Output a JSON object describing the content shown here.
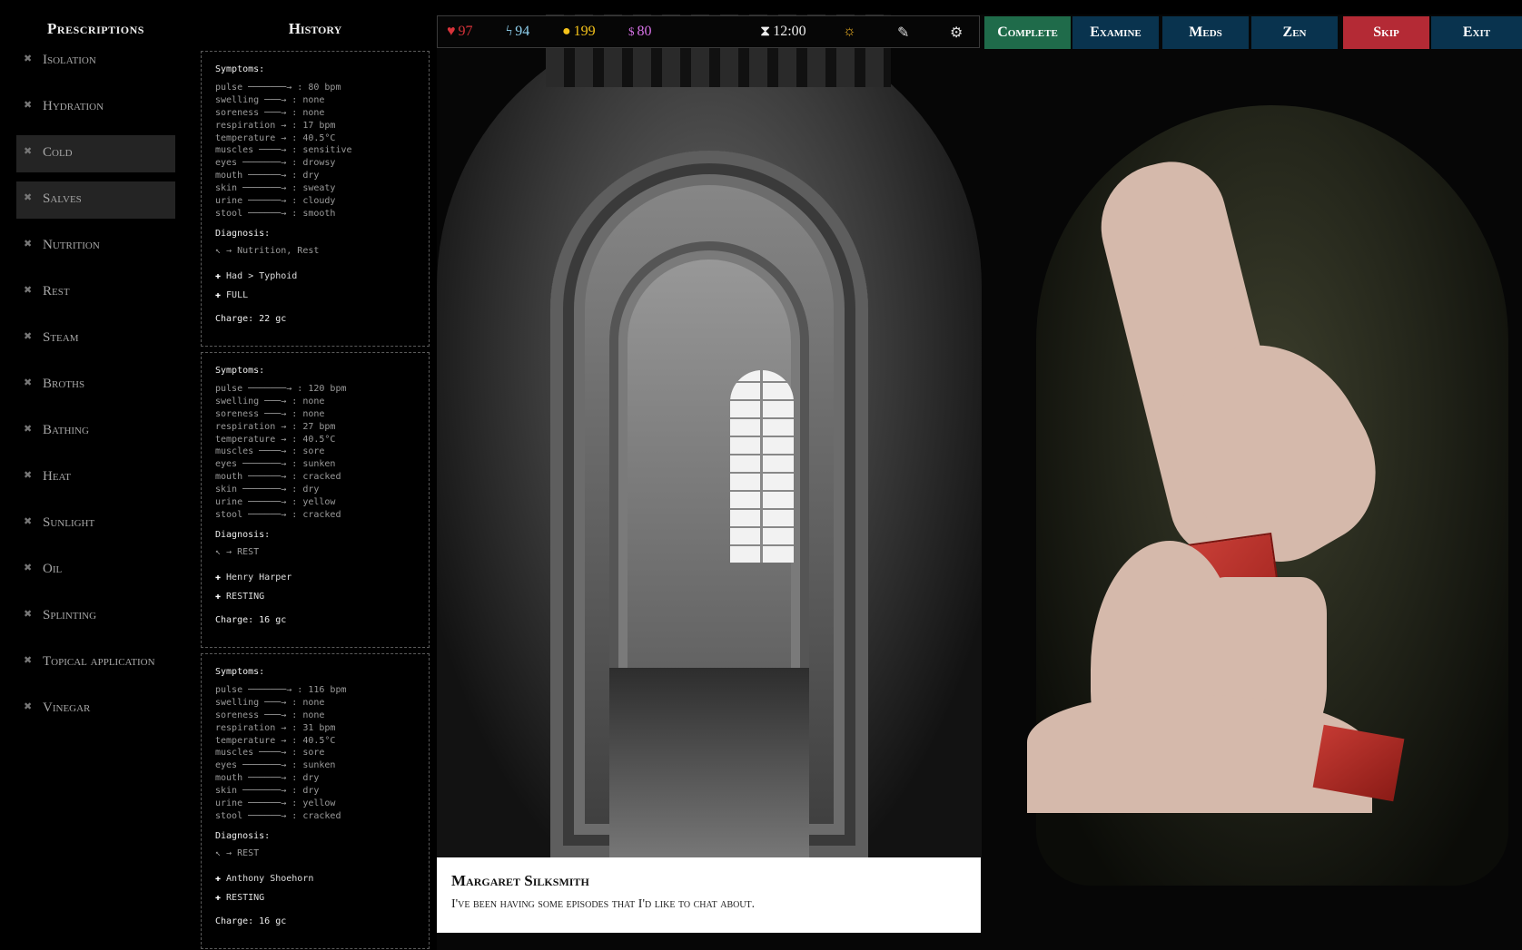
{
  "prescriptions": {
    "title": "Prescriptions",
    "items": [
      {
        "label": "Isolation",
        "selected": false
      },
      {
        "label": "Hydration",
        "selected": false
      },
      {
        "label": "Cold",
        "selected": true
      },
      {
        "label": "Salves",
        "selected": true
      },
      {
        "label": "Nutrition",
        "selected": false
      },
      {
        "label": "Rest",
        "selected": false
      },
      {
        "label": "Steam",
        "selected": false
      },
      {
        "label": "Broths",
        "selected": false
      },
      {
        "label": "Bathing",
        "selected": false
      },
      {
        "label": "Heat",
        "selected": false
      },
      {
        "label": "Sunlight",
        "selected": false
      },
      {
        "label": "Oil",
        "selected": false
      },
      {
        "label": "Splinting",
        "selected": false
      },
      {
        "label": "Topical application",
        "selected": false
      },
      {
        "label": "Vinegar",
        "selected": false
      }
    ]
  },
  "history": {
    "title": "History",
    "symptoms_heading": "Symptoms:",
    "diagnosis_heading": "Diagnosis:",
    "cards": [
      {
        "symptoms": [
          "pulse ───────→ : 80 bpm",
          "swelling ───→ : none",
          "soreness ───→ : none",
          "respiration → : 17 bpm",
          "temperature → : 40.5°C",
          "muscles ────→ : sensitive",
          "eyes ───────→ : drowsy",
          "mouth ──────→ : dry",
          "skin ───────→ : sweaty",
          "urine ──────→ : cloudy",
          "stool ──────→ : smooth"
        ],
        "diagnosis": "↖ → Nutrition, Rest",
        "tags": [
          "Had > Typhoid",
          "FULL"
        ],
        "charge": "Charge: 22 gc"
      },
      {
        "symptoms": [
          "pulse ───────→ : 120 bpm",
          "swelling ───→ : none",
          "soreness ───→ : none",
          "respiration → : 27 bpm",
          "temperature → : 40.5°C",
          "muscles ────→ : sore",
          "eyes ───────→ : sunken",
          "mouth ──────→ : cracked",
          "skin ───────→ : dry",
          "urine ──────→ : yellow",
          "stool ──────→ : cracked"
        ],
        "diagnosis": "↖ → REST",
        "tags": [
          "Henry Harper",
          "RESTING"
        ],
        "charge": "Charge: 16 gc"
      },
      {
        "symptoms": [
          "pulse ───────→ : 116 bpm",
          "swelling ───→ : none",
          "soreness ───→ : none",
          "respiration → : 31 bpm",
          "temperature → : 40.5°C",
          "muscles ────→ : sore",
          "eyes ───────→ : sunken",
          "mouth ──────→ : dry",
          "skin ───────→ : dry",
          "urine ──────→ : yellow",
          "stool ──────→ : cracked"
        ],
        "diagnosis": "↖ → REST",
        "tags": [
          "Anthony Shoehorn",
          "RESTING"
        ],
        "charge": "Charge: 16 gc"
      }
    ]
  },
  "hud": {
    "health": "97",
    "energy": "94",
    "coins": "199",
    "money": "80",
    "time": "12:00",
    "icons": [
      "heart-icon",
      "bolt-icon",
      "coin-icon",
      "dollar-icon",
      "hourglass-icon",
      "sun-icon",
      "journal-icon",
      "settings-icon"
    ]
  },
  "actions": {
    "complete": "Complete",
    "examine": "Examine",
    "meds": "Meds",
    "zen": "Zen",
    "skip": "Skip",
    "exit": "Exit"
  },
  "colors": {
    "complete": "#1f6b4a",
    "examine": "#09334e",
    "skip": "#b42a35",
    "health": "#d8333a",
    "energy": "#8fd0ee",
    "coins": "#f4c21a",
    "money": "#d873e8"
  },
  "dialog": {
    "name": "Margaret Silksmith",
    "text": "I've been having some episodes that I'd like to chat about."
  }
}
